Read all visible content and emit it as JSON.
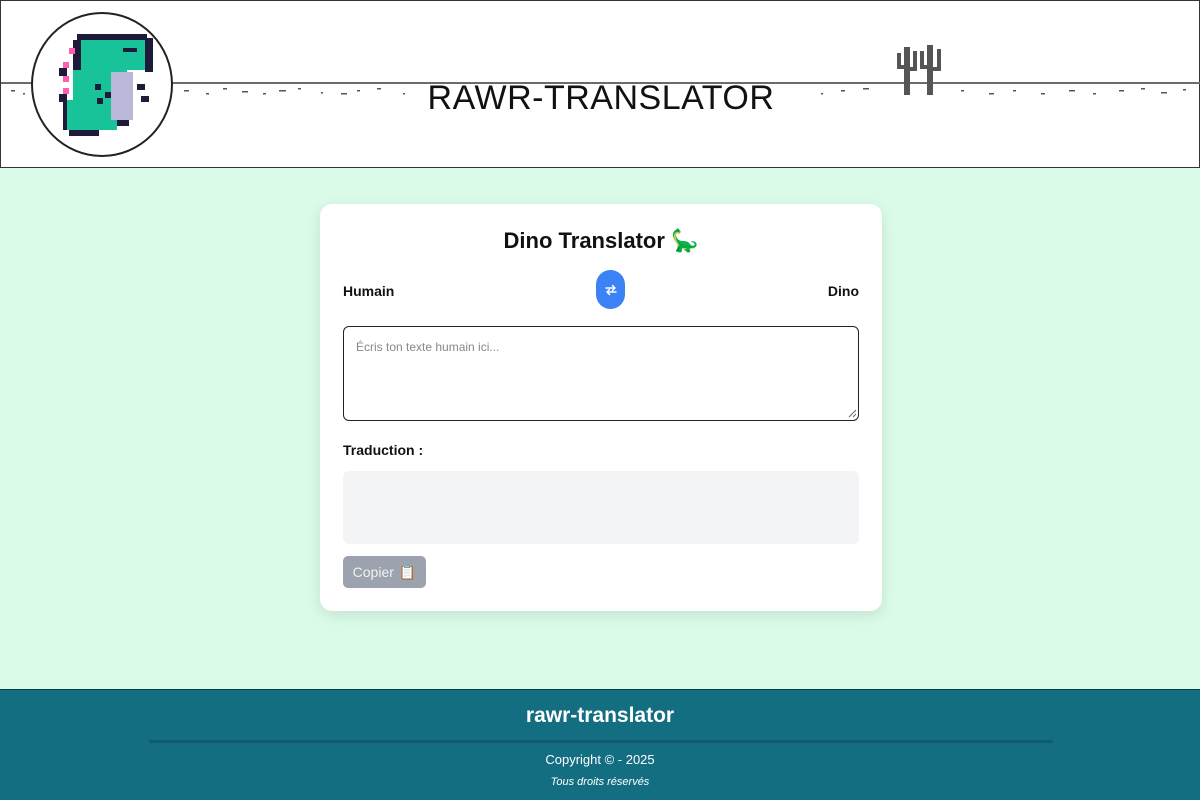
{
  "header": {
    "title": "RAWR-TRANSLATOR",
    "logo_icon": "pixel-dino-logo",
    "cactus_icon": "cactus-icon"
  },
  "card": {
    "title": "Dino Translator",
    "title_emoji": "🦕",
    "source_language": "Humain",
    "target_language": "Dino",
    "swap_icon": "swap-arrows-icon",
    "input_placeholder": "Écris ton texte humain ici...",
    "input_value": "",
    "translation_label": "Traduction :",
    "translation_output": "",
    "copy_label": "Copier",
    "copy_emoji": "📋"
  },
  "footer": {
    "title": "rawr-translator",
    "copyright": "Copyright © - 2025",
    "rights": "Tous droits réservés"
  },
  "colors": {
    "page_background": "#dafbe8",
    "accent_blue": "#3b82f6",
    "footer_teal": "#146e82",
    "dino_green": "#19c39a",
    "copy_disabled": "#9ca3af"
  }
}
